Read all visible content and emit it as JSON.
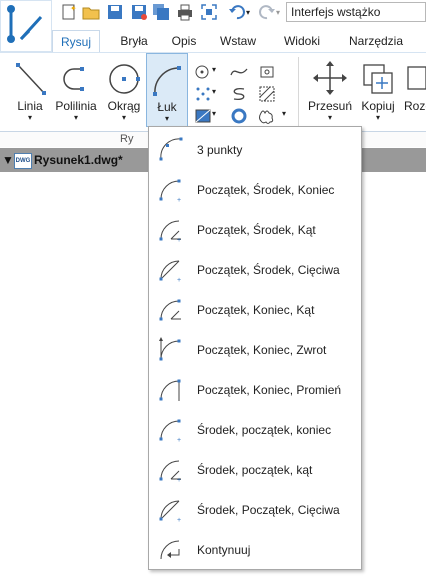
{
  "search": {
    "placeholder": "Interfejs wstążko"
  },
  "tabs": [
    "Rysuj",
    "Bryła",
    "Opis",
    "Wstaw",
    "Widoki",
    "Narzędzia"
  ],
  "ribbon": {
    "buttons": [
      "Linia",
      "Polilinia",
      "Okrąg",
      "Łuk",
      "Przesuń",
      "Kopiuj",
      "Roze"
    ],
    "group_label": "Ry"
  },
  "document": {
    "name": "Rysunek1.dwg*",
    "icon_text": "DWG"
  },
  "arc_menu": {
    "items": [
      "3 punkty",
      "Początek, Środek, Koniec",
      "Początek, Środek, Kąt",
      "Początek, Środek, Cięciwa",
      "Początek, Koniec, Kąt",
      "Początek, Koniec, Zwrot",
      "Początek, Koniec, Promień",
      "Środek, początek, koniec",
      "Środek, początek, kąt",
      "Środek, Początek, Cięciwa",
      "Kontynuuj"
    ]
  },
  "colors": {
    "accent": "#1f6fb8",
    "active_bg": "#dbeaf7",
    "doc_bar": "#999999"
  }
}
